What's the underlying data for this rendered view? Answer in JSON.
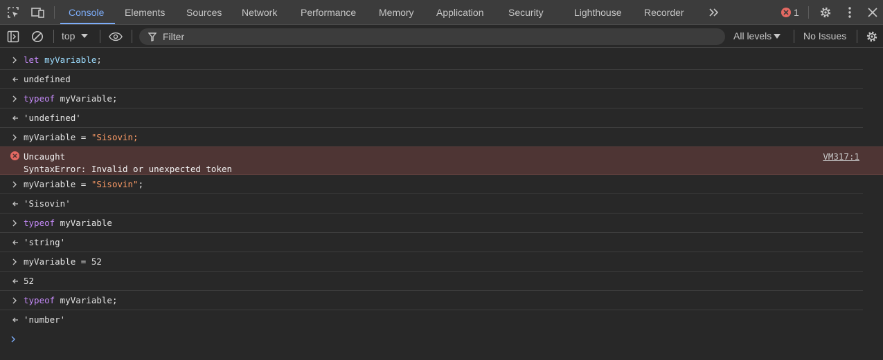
{
  "tabs": [
    {
      "label": "Console",
      "active": true
    },
    {
      "label": "Elements"
    },
    {
      "label": "Sources"
    },
    {
      "label": "Network"
    },
    {
      "label": "Performance"
    },
    {
      "label": "Memory"
    },
    {
      "label": "Application"
    },
    {
      "label": "Security"
    },
    {
      "label": "Lighthouse"
    },
    {
      "label": "Recorder"
    }
  ],
  "error_count": "1",
  "toolbar": {
    "context": "top",
    "filter_placeholder": "Filter",
    "levels": "All levels",
    "issues": "No Issues"
  },
  "console": {
    "r1": {
      "kw": "let",
      "var": "myVariable",
      "rest": ";"
    },
    "r2": {
      "text": "undefined"
    },
    "r3": {
      "kw": "typeof",
      "rest": " myVariable;"
    },
    "r4": {
      "text": "'undefined'"
    },
    "r5": {
      "pre": "myVariable = ",
      "str": "\"Sisovin;"
    },
    "err": {
      "title": "Uncaught",
      "message": "SyntaxError: Invalid or unexpected token",
      "source": "VM317:1"
    },
    "r6": {
      "pre": "myVariable = ",
      "str": "\"Sisovin\"",
      "rest": ";"
    },
    "r7": {
      "text": "'Sisovin'"
    },
    "r8": {
      "kw": "typeof",
      "rest": " myVariable"
    },
    "r9": {
      "text": "'string'"
    },
    "r10": {
      "pre": "myVariable = ",
      "num": "52"
    },
    "r11": {
      "text": "52"
    },
    "r12": {
      "kw": "typeof",
      "rest": " myVariable;"
    },
    "r13": {
      "text": "'number'"
    }
  },
  "colors": {
    "accent": "#7cacf8",
    "error": "#e46962",
    "keyword": "#c58af9",
    "string": "#fc9b66",
    "result_string": "#5cd5fb",
    "number": "#9980ff"
  }
}
